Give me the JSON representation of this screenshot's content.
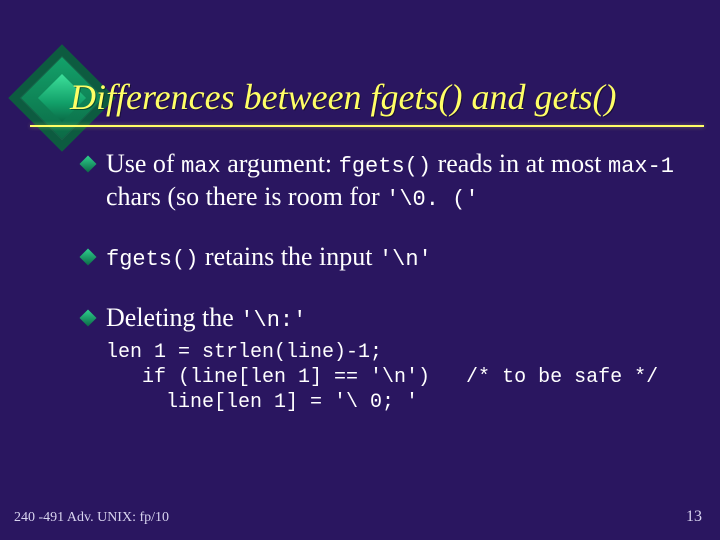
{
  "title": "Differences between fgets() and gets()",
  "bullets": [
    {
      "pre": "Use of ",
      "code1": "max",
      "mid1": " argument: ",
      "code2": "fgets()",
      "mid2": " reads in at most ",
      "code3": "max-1",
      "mid3": " chars (so there is room for ",
      "code4": "'\\0. ('"
    },
    {
      "code1": "fgets()",
      "mid1": " retains the input ",
      "code2": "'\\n'"
    },
    {
      "pre": "Deleting the ",
      "code1": "'\\n:'"
    }
  ],
  "code_lines": [
    "len 1 = strlen(line)-1;",
    "   if (line[len 1] == '\\n')   /* to be safe */",
    "     line[len 1] = '\\ 0; '"
  ],
  "footer_left": "240 -491 Adv. UNIX: fp/10",
  "footer_right": "13"
}
